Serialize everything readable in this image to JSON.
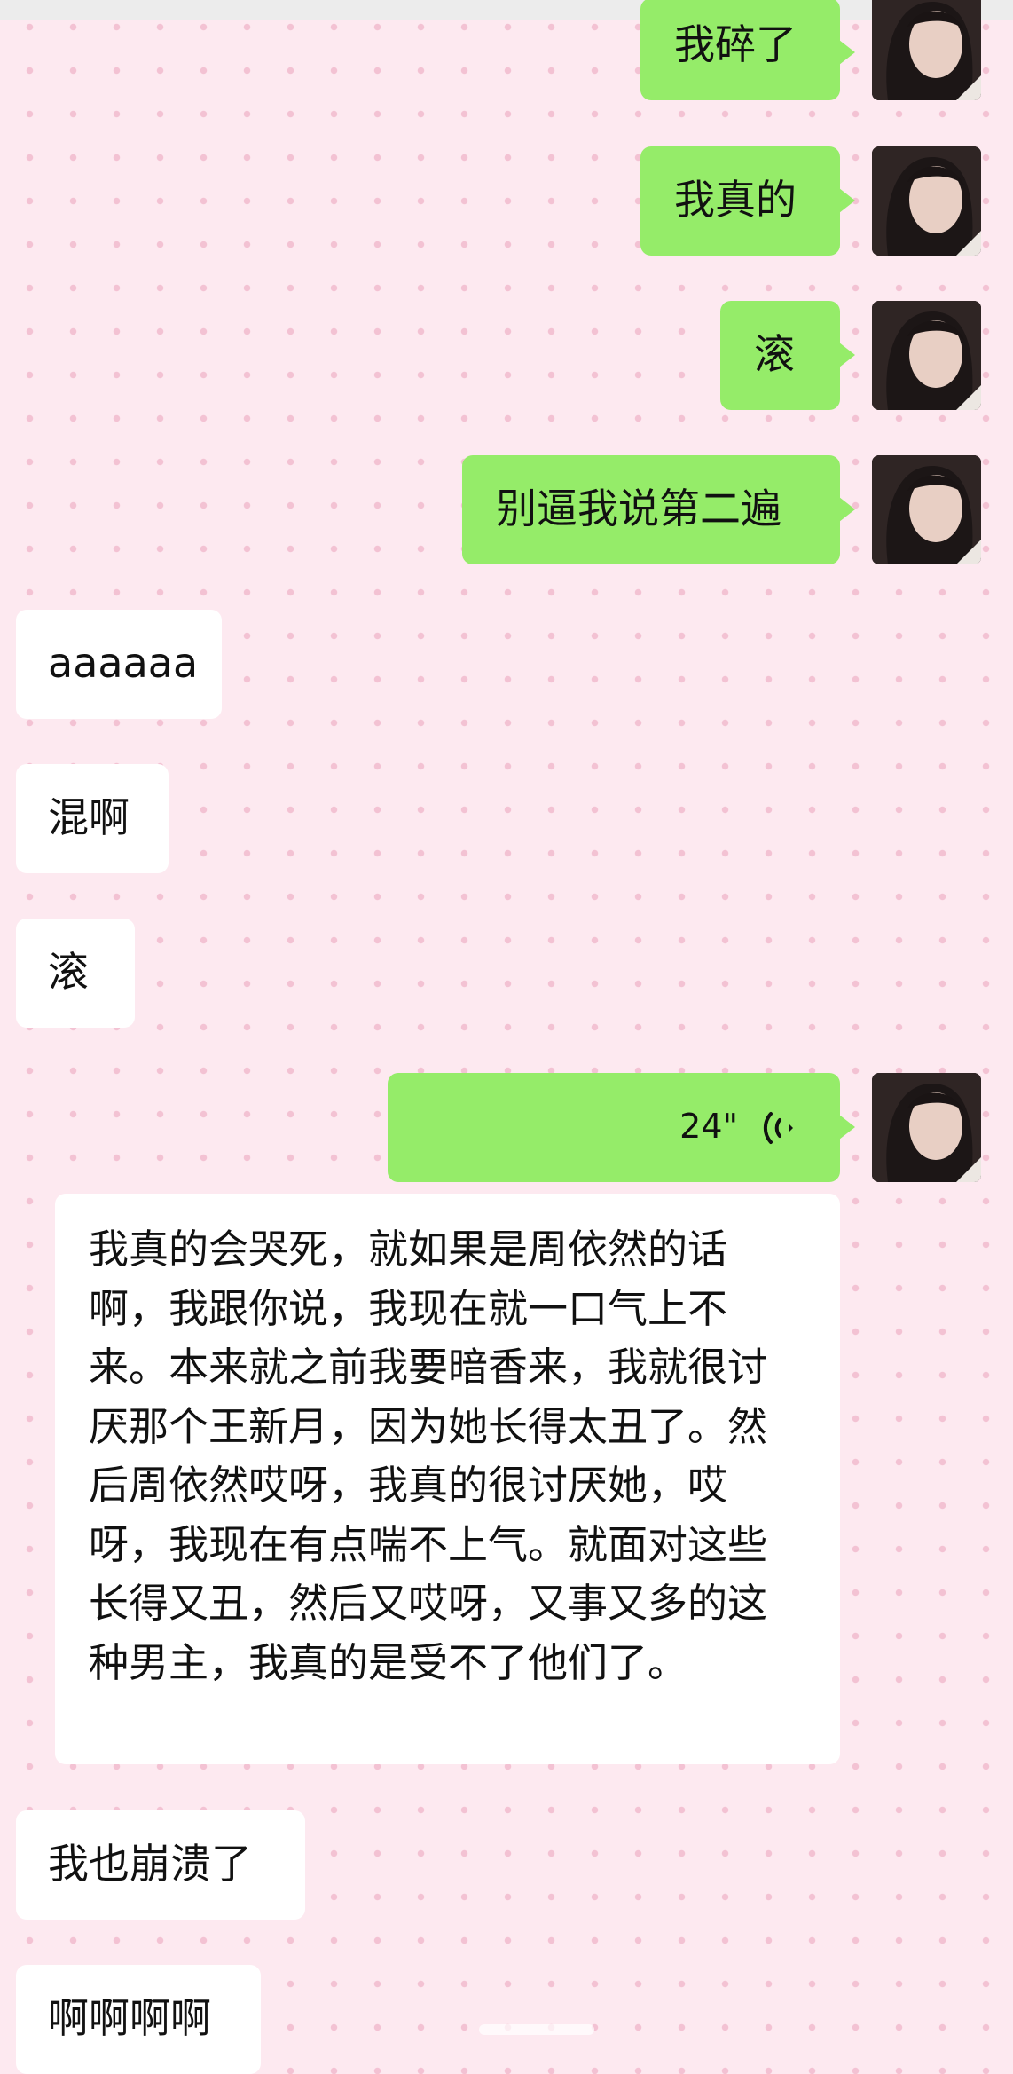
{
  "chat": {
    "outgoing": {
      "m1": "我碎了",
      "m2": "我真的",
      "m3": "滚",
      "m4": "别逼我说第二遍",
      "voice": {
        "duration": "24\"",
        "icon": "voice-wave-icon"
      }
    },
    "incoming": {
      "m1": "aaaaaa",
      "m2": "混啊",
      "m3": "滚",
      "transcript": "我真的会哭死，就如果是周依然的话啊，我跟你说，我现在就一口气上不来。本来就之前我要暗香来，我就很讨厌那个王新月，因为她长得太丑了。然后周依然哎呀，我真的很讨厌她，哎呀，我现在有点喘不上气。就面对这些长得又丑，然后又哎呀，又事又多的这种男主，我真的是受不了他们了。",
      "m4": "我也崩溃了",
      "m5": "啊啊啊啊"
    }
  },
  "colors": {
    "outgoing_bubble": "#95ec69",
    "incoming_bubble": "#ffffff",
    "background": "#fde9f0",
    "dot": "#f3c2d3"
  }
}
